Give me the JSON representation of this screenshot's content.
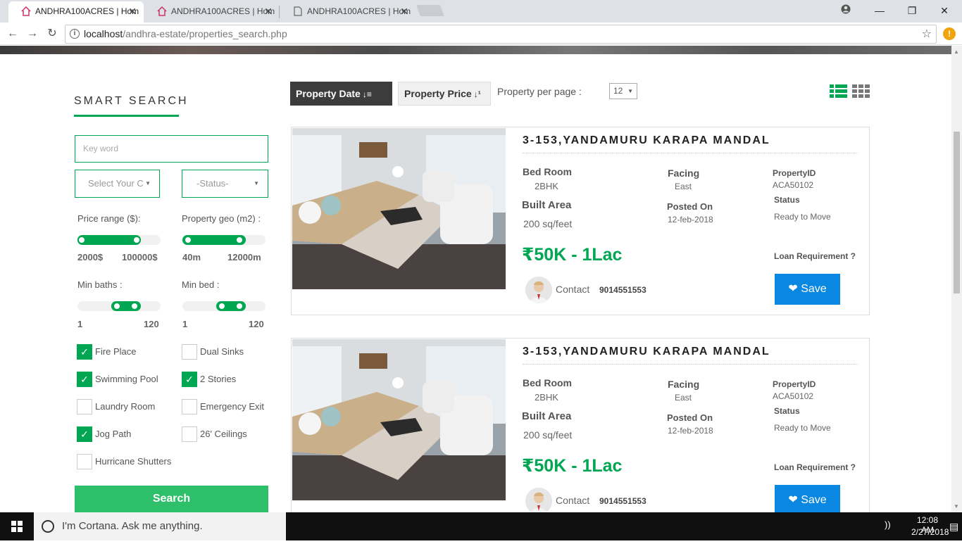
{
  "browser": {
    "tabs": [
      {
        "title": "ANDHRA100ACRES | Hom",
        "icon": "house-favicon",
        "active": true
      },
      {
        "title": "ANDHRA100ACRES | Hom",
        "icon": "house-favicon",
        "active": false
      },
      {
        "title": "ANDHRA100ACRES | Hom",
        "icon": "page-icon",
        "active": false
      }
    ],
    "close_glyph": "✕",
    "url_host": "localhost",
    "url_path": "/andhra-estate/properties_search.php",
    "alert_badge": "!"
  },
  "sidebar": {
    "title": "SMART SEARCH",
    "keyword_placeholder": "Key word",
    "city_select": "Select Your C",
    "status_select": "-Status-",
    "price_label": "Price range ($):",
    "price_min": "2000$",
    "price_max": "100000$",
    "geo_label": "Property geo (m2) :",
    "geo_min": "40m",
    "geo_max": "12000m",
    "baths_label": "Min baths :",
    "baths_min": "1",
    "baths_max": "120",
    "bed_label": "Min bed :",
    "bed_min": "1",
    "bed_max": "120",
    "amenities": [
      {
        "label": "Fire Place",
        "checked": true
      },
      {
        "label": "Dual Sinks",
        "checked": false
      },
      {
        "label": "Swimming Pool",
        "checked": true
      },
      {
        "label": "2 Stories",
        "checked": true
      },
      {
        "label": "Laundry Room",
        "checked": false
      },
      {
        "label": "Emergency Exit",
        "checked": false
      },
      {
        "label": "Jog Path",
        "checked": true
      },
      {
        "label": "26' Ceilings",
        "checked": false
      },
      {
        "label": "Hurricane Shutters",
        "checked": false
      }
    ],
    "search_label": "Search"
  },
  "toolbar": {
    "sort_date": "Property Date",
    "sort_price": "Property Price",
    "per_page_label": "Property per page :",
    "per_page_value": "12"
  },
  "listings": [
    {
      "title": "3-153,YANDAMURU KARAPA MANDAL",
      "bed_label": "Bed Room",
      "bed_value": "2BHK",
      "facing_label": "Facing",
      "facing_value": "East",
      "id_label": "PropertyID",
      "id_value": "ACA50102",
      "area_label": "Built Area",
      "area_value": "200 sq/feet",
      "posted_label": "Posted On",
      "posted_value": "12-feb-2018",
      "status_label": "Status",
      "status_value": "Ready to Move",
      "price": "₹50K - 1Lac",
      "loan_label": "Loan Requirement ?",
      "contact_label": "Contact",
      "phone": "9014551553",
      "save_label": "Save"
    },
    {
      "title": "3-153,YANDAMURU KARAPA MANDAL",
      "bed_label": "Bed Room",
      "bed_value": "2BHK",
      "facing_label": "Facing",
      "facing_value": "East",
      "id_label": "PropertyID",
      "id_value": "ACA50102",
      "area_label": "Built Area",
      "area_value": "200 sq/feet",
      "posted_label": "Posted On",
      "posted_value": "12-feb-2018",
      "status_label": "Status",
      "status_value": "Ready to Move",
      "price": "₹50K - 1Lac",
      "loan_label": "Loan Requirement ?",
      "contact_label": "Contact",
      "phone": "9014551553",
      "save_label": "Save"
    }
  ],
  "taskbar": {
    "cortana": "I'm Cortana. Ask me anything.",
    "time": "12:08 AM",
    "date": "2/27/2018"
  },
  "colors": {
    "accent": "#00a651",
    "save": "#0a87e0",
    "sort_active": "#3c3c3c"
  }
}
